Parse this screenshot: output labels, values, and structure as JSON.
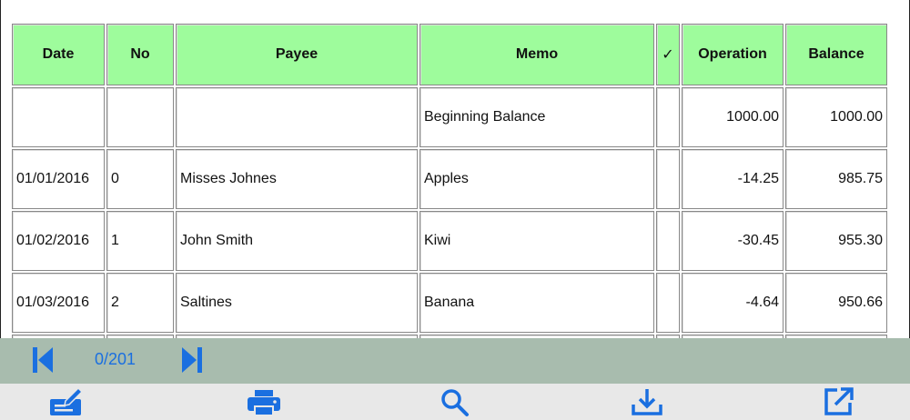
{
  "table": {
    "headers": [
      "Date",
      "No",
      "Payee",
      "Memo",
      "✓",
      "Operation",
      "Balance"
    ],
    "rows": [
      {
        "date": "",
        "no": "",
        "payee": "",
        "memo": "Beginning Balance",
        "check": "",
        "operation": "1000.00",
        "balance": "1000.00"
      },
      {
        "date": "01/01/2016",
        "no": "0",
        "payee": "Misses Johnes",
        "memo": "Apples",
        "check": "",
        "operation": "-14.25",
        "balance": "985.75"
      },
      {
        "date": "01/02/2016",
        "no": "1",
        "payee": "John Smith",
        "memo": "Kiwi",
        "check": "",
        "operation": "-30.45",
        "balance": "955.30"
      },
      {
        "date": "01/03/2016",
        "no": "2",
        "payee": "Saltines",
        "memo": "Banana",
        "check": "",
        "operation": "-4.64",
        "balance": "950.66"
      },
      {
        "date": "",
        "no": "",
        "payee": "",
        "memo": "",
        "check": "",
        "operation": "",
        "balance": ""
      }
    ]
  },
  "pager": {
    "count": "0/201"
  },
  "toolbar": {
    "items": [
      "edit-check-icon",
      "print-icon",
      "search-icon",
      "download-icon",
      "open-external-icon"
    ]
  },
  "colors": {
    "header_bg": "#9efc9c",
    "pager_bg": "#a8bcae",
    "toolbar_bg": "#e8e8e8",
    "accent": "#1a6fe0"
  }
}
